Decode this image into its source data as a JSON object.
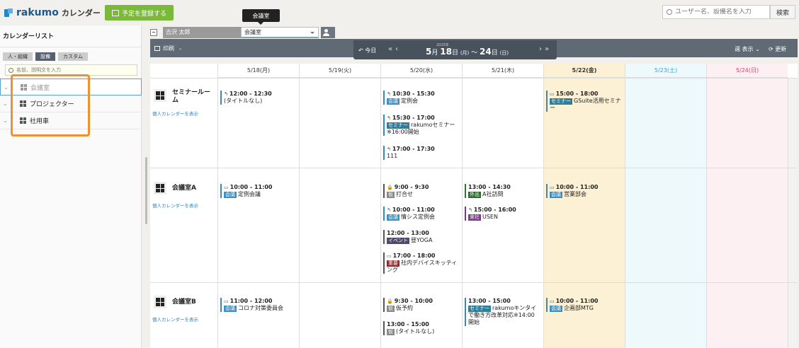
{
  "app": {
    "brand": "rakumo",
    "product": "カレンダー",
    "register_button": "予定を登録する"
  },
  "tooltip": "会議室",
  "global_search": {
    "placeholder": "ユーザー名、設備名を入力",
    "button": "検索"
  },
  "sidebar": {
    "title": "カレンダーリスト",
    "tabs": [
      {
        "label": "人・組織",
        "active": false
      },
      {
        "label": "設備",
        "active": true
      },
      {
        "label": "カスタム",
        "active": false
      }
    ],
    "search_placeholder": "名前、説明文を入力",
    "items": [
      {
        "label": "会議室",
        "selected": true
      },
      {
        "label": "プロジェクター",
        "selected": false
      },
      {
        "label": "社用車",
        "selected": false
      }
    ]
  },
  "header": {
    "user": "吉沢 太郎",
    "facility": "会議室"
  },
  "toolbar": {
    "print": "印刷",
    "today": "今日",
    "year": "2020年",
    "range_start_month": "5",
    "range_start_day": "18",
    "range_start_dow": "(月)",
    "range_sep": "〜",
    "range_end_day": "24",
    "range_end_dow": "(日)",
    "view": "週 表示",
    "refresh": "更新"
  },
  "days": [
    "5/18(月)",
    "5/19(火)",
    "5/20(水)",
    "5/21(木)",
    "5/22(金)",
    "5/23(土)",
    "5/24(日)"
  ],
  "resources": [
    {
      "name": "セミナールーム",
      "link": "個人カレンダーを表示"
    },
    {
      "name": "会議室A",
      "link": "個人カレンダーを表示"
    },
    {
      "name": "会議室B",
      "link": "個人カレンダーを表示"
    }
  ],
  "colors": {
    "today": "#fdf1d5",
    "saturday": "#eef9fc",
    "sunday": "#fdf0f3",
    "sat_text": "#3aa0d0",
    "sun_text": "#e04070"
  },
  "events": {
    "r0d0": {
      "time": "12:00 - 12:30",
      "title": "(タイトルなし)"
    },
    "r0d2a": {
      "time": "10:30 - 15:30",
      "tag": "会議",
      "title": "定例会"
    },
    "r0d2b": {
      "time": "15:30 - 17:00",
      "tag": "セミナー",
      "title": "rakumoセミナー※16:00開始"
    },
    "r0d2c": {
      "time": "17:00 - 17:30",
      "title": "111"
    },
    "r0d4": {
      "time": "15:00 - 18:00",
      "tag": "セミナー",
      "title": "GSuite活用セミナー"
    },
    "r1d0": {
      "time": "10:00 - 11:00",
      "tag": "会議",
      "title": "定例会議"
    },
    "r1d2a": {
      "time": "9:00 - 9:30",
      "tag": "仮",
      "title": "打合せ"
    },
    "r1d2b": {
      "time": "10:00 - 11:00",
      "tag": "会議",
      "title": "情シス定例会"
    },
    "r1d2c": {
      "time": "12:00 - 13:00",
      "tag": "イベント",
      "title": "昼YOGA"
    },
    "r1d2d": {
      "time": "17:00 - 18:00",
      "tag": "重要",
      "title": "社内デバイスキッティング"
    },
    "r1d3a": {
      "time": "13:00 - 14:30",
      "tag": "外出",
      "title": "A社訪問"
    },
    "r1d3b": {
      "time": "15:00 - 16:00",
      "tag": "来社",
      "title": "USEN"
    },
    "r1d4": {
      "time": "10:00 - 11:00",
      "tag": "会議",
      "title": "営業部会"
    },
    "r2d0": {
      "time": "11:00 - 12:00",
      "tag": "会議",
      "title": "コロナ対策委員会"
    },
    "r2d2a": {
      "time": "9:30 - 10:00",
      "tag": "仮",
      "title": "仮予約"
    },
    "r2d2b": {
      "time": "13:00 - 15:00",
      "tag": "仮",
      "title": "(タイトルなし)"
    },
    "r2d3": {
      "time": "13:00 - 15:00",
      "tag": "セミナー",
      "title": "rakumoキンタイで働き方改革対応※14:00開始"
    },
    "r2d4": {
      "time": "10:00 - 11:00",
      "tag": "会議",
      "title": "企画部MTG"
    }
  }
}
